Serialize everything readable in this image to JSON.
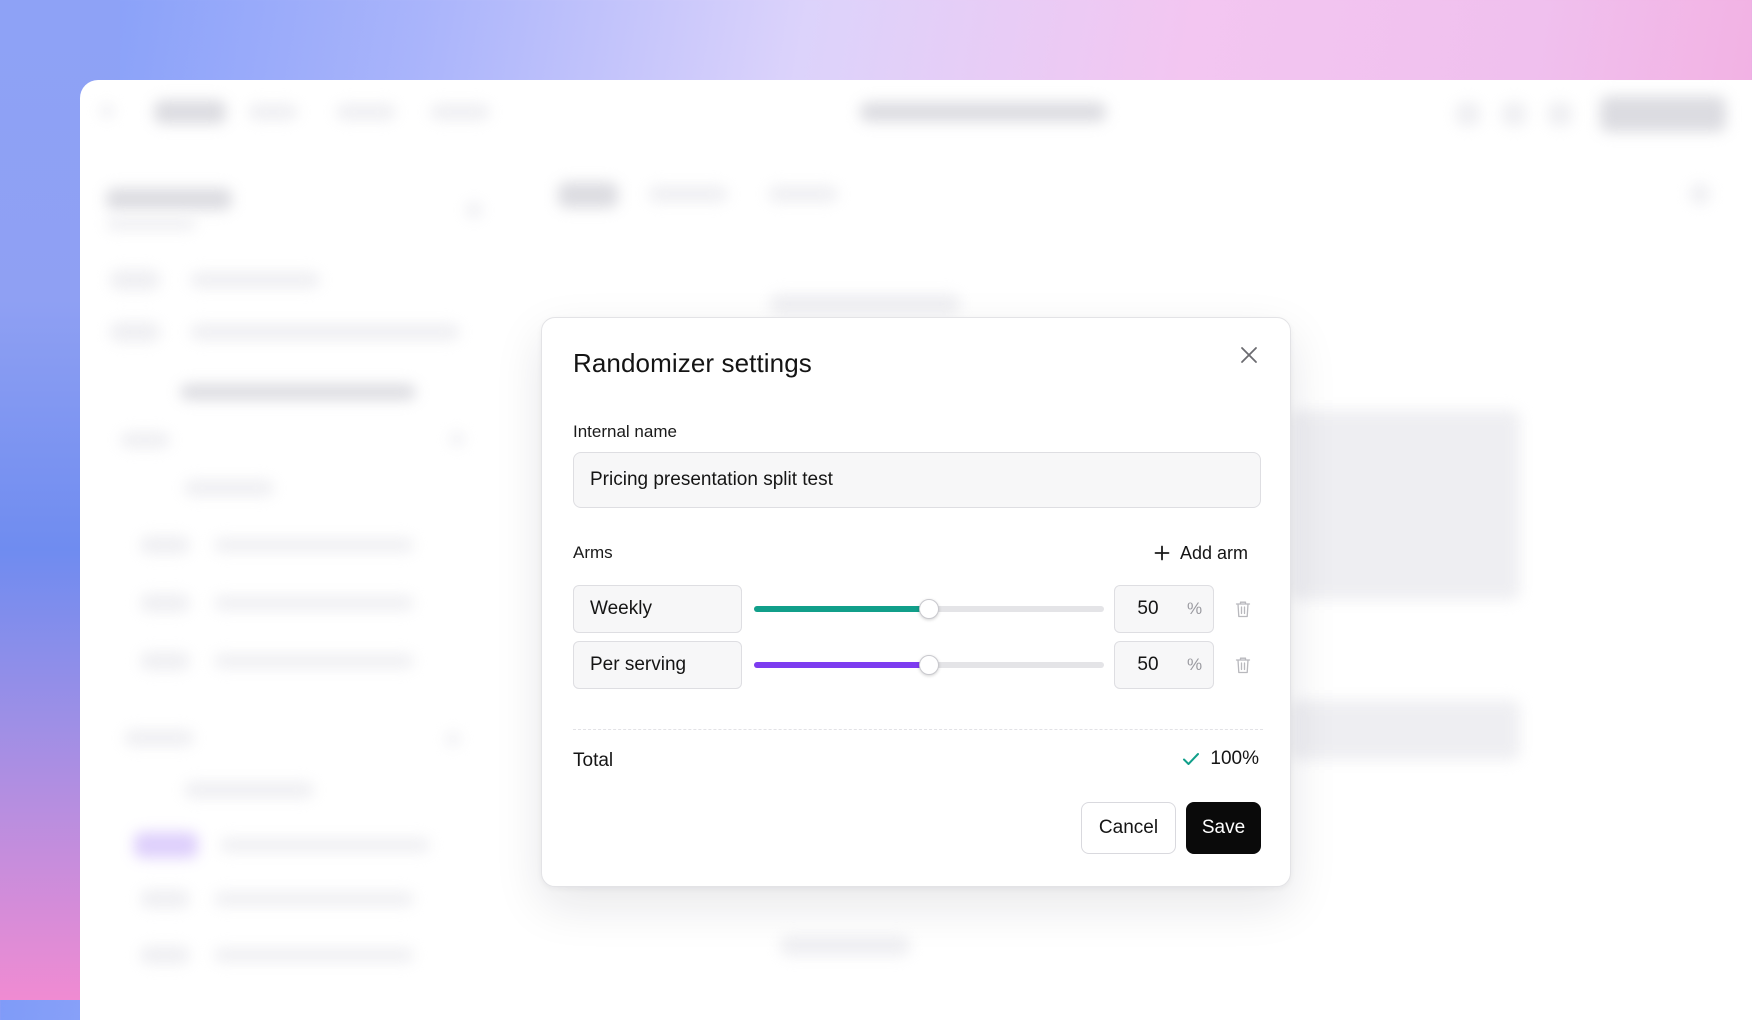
{
  "dialog": {
    "title": "Randomizer settings",
    "internal_name_label": "Internal name",
    "internal_name_value": "Pricing presentation split test",
    "arms_label": "Arms",
    "add_arm_label": "Add arm",
    "arms": [
      {
        "name": "Weekly",
        "percent": "50",
        "percent_unit": "%",
        "color": "#119f8a"
      },
      {
        "name": "Per serving",
        "percent": "50",
        "percent_unit": "%",
        "color": "#7d3cf0"
      }
    ],
    "total_label": "Total",
    "total_value": "100%",
    "total_status_color": "#119f8a",
    "cancel_label": "Cancel",
    "save_label": "Save"
  },
  "icons": {
    "close": "close-icon",
    "add": "plus-icon",
    "delete": "trash-icon",
    "valid": "check-icon"
  }
}
